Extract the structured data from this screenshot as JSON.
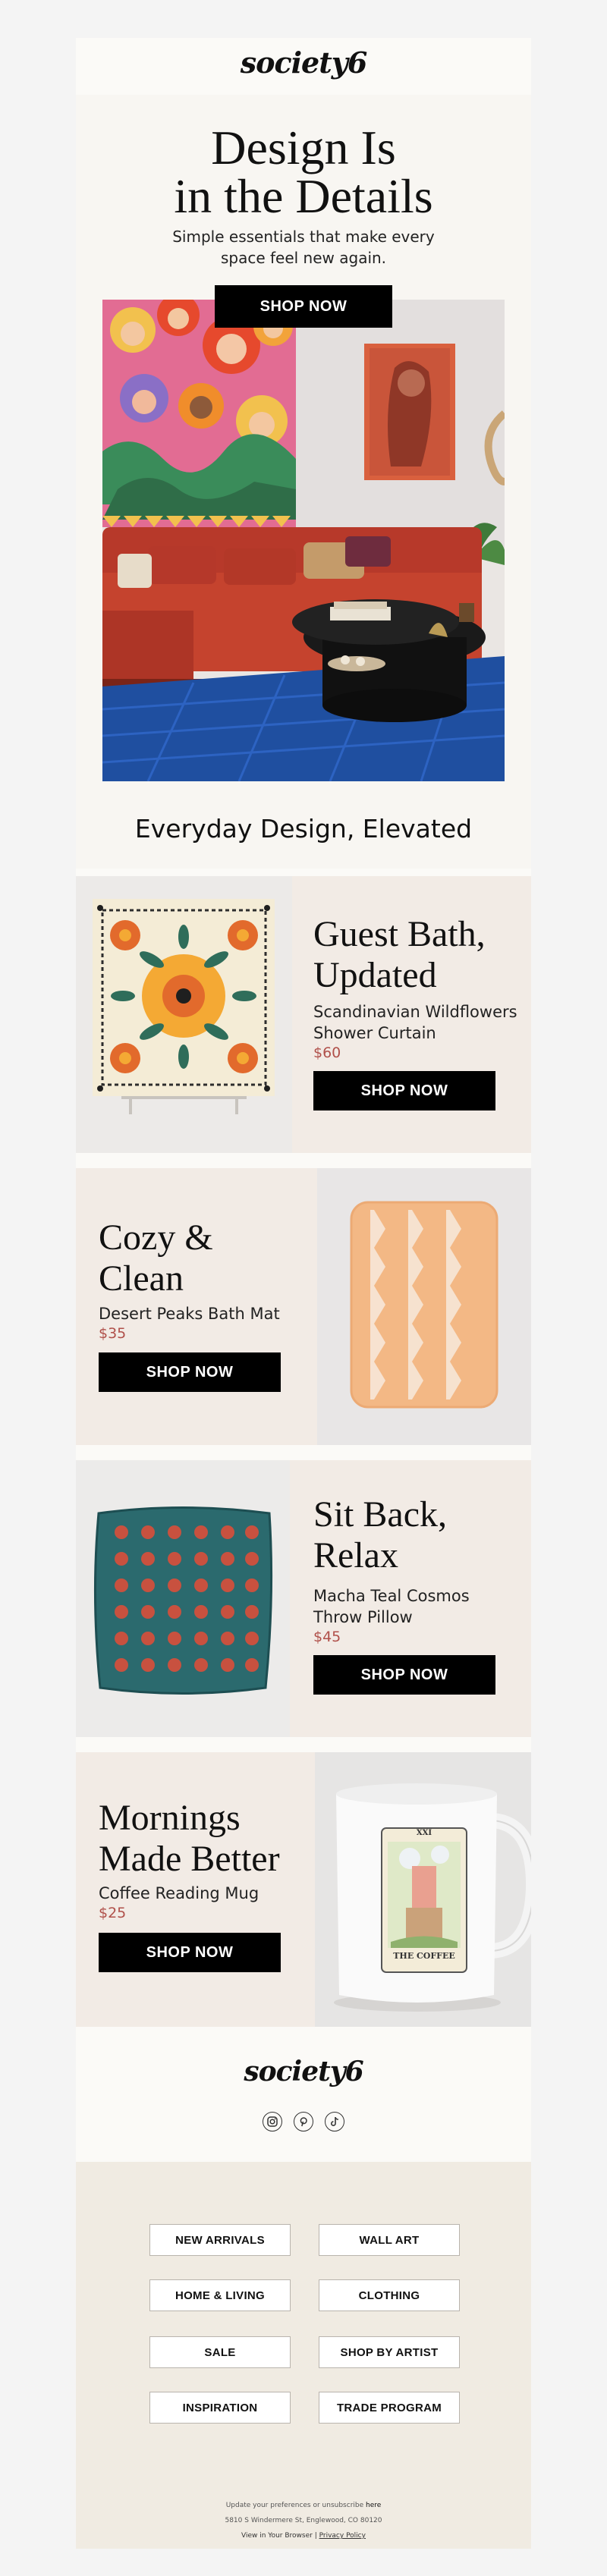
{
  "header": {
    "logo": "society6"
  },
  "hero": {
    "title_line1": "Design Is",
    "title_line2": "in the Details",
    "subtitle_line1": "Simple essentials that make every",
    "subtitle_line2": "space feel new again.",
    "cta": "SHOP NOW"
  },
  "tagline": "Everyday Design, Elevated",
  "products": [
    {
      "title_line1": "Guest Bath,",
      "title_line2": "Updated",
      "name_line1": "Scandinavian Wildflowers",
      "name_line2": "Shower Curtain",
      "price": "$60",
      "cta": "SHOP NOW"
    },
    {
      "title_line1": "Cozy &",
      "title_line2": "Clean",
      "name_line1": "Desert Peaks Bath Mat",
      "price": "$35",
      "cta": "SHOP NOW"
    },
    {
      "title_line1": "Sit Back,",
      "title_line2": "Relax",
      "name_line1": "Macha Teal Cosmos",
      "name_line2": "Throw Pillow",
      "price": "$45",
      "cta": "SHOP NOW"
    },
    {
      "title_line1": "Mornings",
      "title_line2": "Made Better",
      "name_line1": "Coffee Reading Mug",
      "price": "$25",
      "cta": "SHOP NOW"
    }
  ],
  "mug_label": "THE COFFEE",
  "mug_numeral": "XXI",
  "footer": {
    "logo": "society6",
    "social": [
      "instagram-icon",
      "pinterest-icon",
      "tiktok-icon"
    ],
    "nav": [
      "NEW ARRIVALS",
      "WALL ART",
      "HOME & LIVING",
      "CLOTHING",
      "SALE",
      "SHOP BY ARTIST",
      "INSPIRATION",
      "TRADE PROGRAM"
    ],
    "prefs_text": "Update your preferences or unsubscribe",
    "prefs_link": "here",
    "address": "5810 S Windermere St, Englewood, CO 80120",
    "browser_text": "View in Your Browser |",
    "privacy": "Privacy Policy"
  },
  "colors": {
    "panel": "#f2ebe5",
    "price": "#b0504a",
    "footer_bg": "#f0ebe2",
    "sofa": "#c5432e",
    "rug": "#1f4fa0"
  }
}
